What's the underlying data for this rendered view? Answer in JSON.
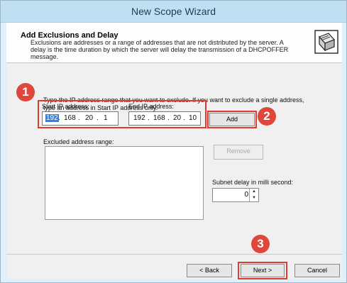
{
  "window": {
    "title": "New Scope Wizard"
  },
  "header": {
    "title": "Add Exclusions and Delay",
    "description": "Exclusions are addresses or a range of addresses that are not distributed by the server. A delay is the time duration by which the server will delay the transmission of a DHCPOFFER message."
  },
  "instructions": "Type the IP address range that you want to exclude. If you want to exclude a single address, type an address in Start IP address only.",
  "start_ip": {
    "label": "Start IP address:",
    "octets": [
      "192",
      "168",
      "20",
      "1"
    ]
  },
  "end_ip": {
    "label": "End IP address:",
    "octets": [
      "192",
      "168",
      "20",
      "10"
    ]
  },
  "buttons": {
    "add": "Add",
    "remove": "Remove",
    "back": "< Back",
    "next": "Next >",
    "cancel": "Cancel"
  },
  "excluded": {
    "label": "Excluded address range:",
    "items": []
  },
  "delay": {
    "label": "Subnet delay in milli second:",
    "value": "0"
  },
  "badges": {
    "step1": "1",
    "step2": "2",
    "step3": "3"
  },
  "colors": {
    "highlight": "#e23b2e",
    "badge": "#e0463a",
    "title_bar": "#bfe0f2"
  },
  "icons": {
    "wizard": "wizard-computer-icon",
    "spin": "spin-arrows-icon"
  }
}
